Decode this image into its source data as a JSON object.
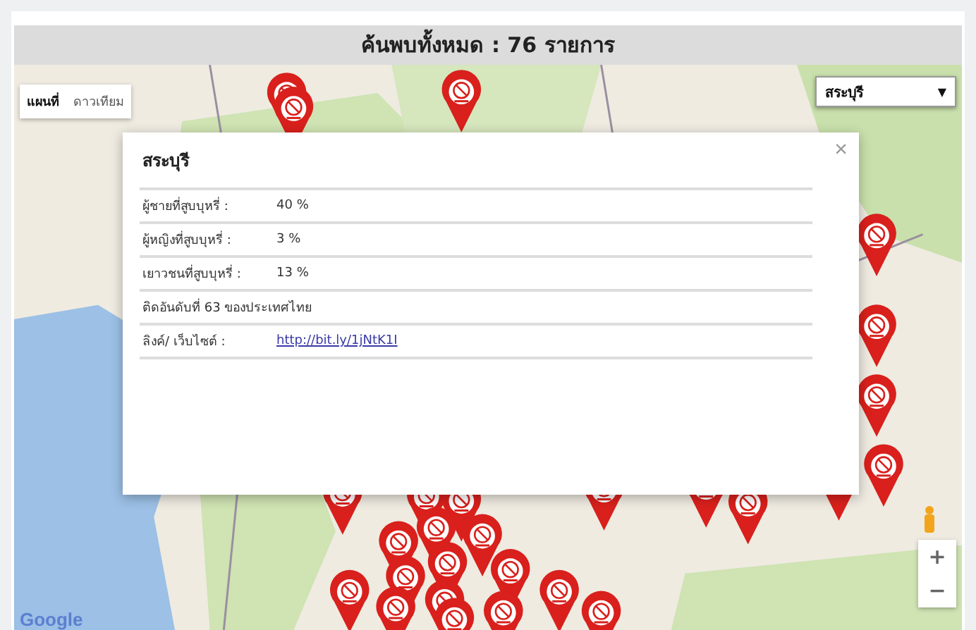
{
  "header": {
    "title": "ค้นพบทั้งหมด : 76 รายการ"
  },
  "map": {
    "type_buttons": [
      {
        "label": "แผนที่",
        "selected": true
      },
      {
        "label": "ดาวเทียม",
        "selected": false
      }
    ],
    "province_select": {
      "value": "สระบุรี",
      "arrow": "▼"
    },
    "zoom_buttons": [
      "+",
      "−"
    ],
    "logo": "Google"
  },
  "popup": {
    "title": "สระบุรี",
    "close": "×",
    "rows": [
      {
        "kind": "pair",
        "label": "ผู้ชายที่สูบบุหรี่ :",
        "value": "40 %"
      },
      {
        "kind": "pair",
        "label": "ผู้หญิงที่สูบบุหรี่ :",
        "value": "3 %"
      },
      {
        "kind": "pair",
        "label": "เยาวชนที่สูบบุหรี่ :",
        "value": "13 %"
      },
      {
        "kind": "text",
        "text": "ติดอันดับที่ 63 ของประเทศไทย"
      },
      {
        "kind": "link",
        "label": "ลิงค์/ เว็บไซต์ :",
        "value": "http://bit.ly/1jNtK1I"
      }
    ]
  }
}
